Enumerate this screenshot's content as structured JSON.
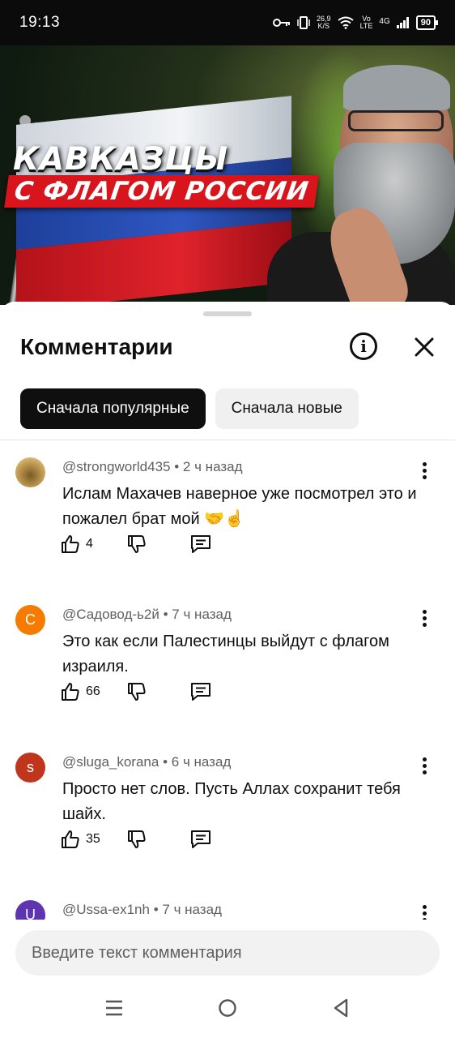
{
  "status_bar": {
    "time": "19:13",
    "net_speed_value": "26,9",
    "net_speed_unit": "K/S",
    "volte_top": "Vo",
    "volte_bottom": "LTE",
    "network": "4G",
    "battery": "90"
  },
  "video": {
    "title_line1": "КАВКАЗЦЫ",
    "title_line2": "С ФЛАГОМ РОССИИ"
  },
  "comments_panel": {
    "title": "Комментарии",
    "sort_chips": [
      {
        "label": "Сначала популярные",
        "active": true
      },
      {
        "label": "Сначала новые",
        "active": false
      }
    ],
    "comments": [
      {
        "author": "@strongworld435",
        "time": "2 ч назад",
        "avatar_letter": "",
        "avatar_color": "#c9a35a",
        "text": "Ислам Махачев наверное уже посмотрел это и пожалел брат мой 🤝☝️",
        "likes": "4"
      },
      {
        "author": "@Садовод-ь2й",
        "time": "7 ч назад",
        "avatar_letter": "С",
        "avatar_color": "#f57c00",
        "text": "Это как если Палестинцы выйдут с флагом израиля.",
        "likes": "66"
      },
      {
        "author": "@sluga_korana",
        "time": "6 ч назад",
        "avatar_letter": "s",
        "avatar_color": "#c0361d",
        "text": "Просто нет слов. Пусть Аллах сохранит тебя шайх.",
        "likes": "35"
      },
      {
        "author": "@Ussa-ex1nh",
        "time": "7 ч назад",
        "avatar_letter": "U",
        "avatar_color": "#5e35b1",
        "text": "",
        "likes": ""
      }
    ],
    "composer_placeholder": "Введите текст комментария"
  }
}
